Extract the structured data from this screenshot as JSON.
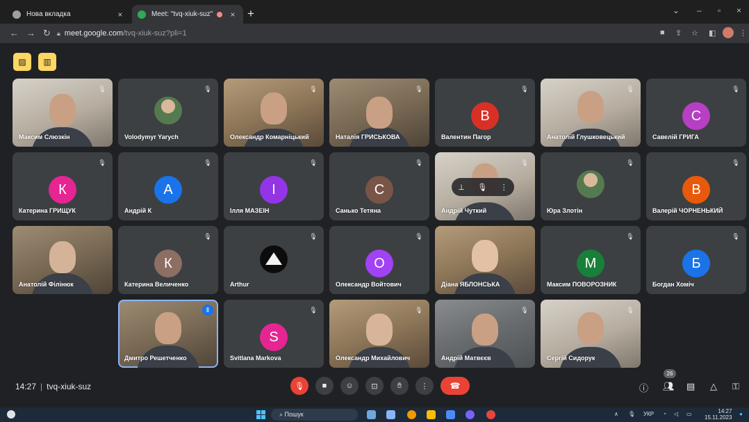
{
  "browser": {
    "tabs": [
      {
        "label": "Нова вкладка"
      },
      {
        "label": "Meet: \"tvq-xiuk-suz\""
      }
    ],
    "url_host": "meet.google.com",
    "url_path": "/tvq-xiuk-suz?pli=1"
  },
  "participants": [
    {
      "name": "Максим Слюзкін",
      "type": "video"
    },
    {
      "name": "Volodymyr Yarych",
      "type": "photo"
    },
    {
      "name": "Олександр Комарніцький",
      "type": "video"
    },
    {
      "name": "Наталія ГРИСЬКОВА",
      "type": "video"
    },
    {
      "name": "Валентин Пагор",
      "initial": "В",
      "color": "#d93025",
      "type": "initial"
    },
    {
      "name": "Анатолій Глушковецький",
      "type": "video"
    },
    {
      "name": "Савелій ГРИГА",
      "initial": "С",
      "color": "#b63fc4",
      "type": "initial"
    },
    {
      "name": "Катерина ГРИЩУК",
      "initial": "К",
      "color": "#e52592",
      "type": "initial"
    },
    {
      "name": "Андрій К",
      "initial": "А",
      "color": "#1a73e8",
      "type": "initial"
    },
    {
      "name": "Ілля МАЗЕІН",
      "initial": "І",
      "color": "#9334e6",
      "type": "initial"
    },
    {
      "name": "Санько Тетяна",
      "initial": "С",
      "color": "#795548",
      "type": "initial"
    },
    {
      "name": "Андрій Чуткий",
      "type": "video"
    },
    {
      "name": "Юра Злотін",
      "type": "photo"
    },
    {
      "name": "Валерій ЧОРНЕНЬКИЙ",
      "initial": "В",
      "color": "#e8590c",
      "type": "initial"
    },
    {
      "name": "Анатолій Філінюк",
      "type": "video"
    },
    {
      "name": "Катерина Величенко",
      "initial": "К",
      "color": "#8d6e63",
      "type": "initial"
    },
    {
      "name": "Arthur",
      "type": "logo"
    },
    {
      "name": "Олександр Войтович",
      "initial": "О",
      "color": "#a142f4",
      "type": "initial"
    },
    {
      "name": "Діана ЯБЛОНСЬКА",
      "type": "video"
    },
    {
      "name": "Максим ПОВОРОЗНИК",
      "initial": "М",
      "color": "#188038",
      "type": "initial"
    },
    {
      "name": "Богдан Хоміч",
      "initial": "Б",
      "color": "#1a73e8",
      "type": "initial"
    },
    {
      "name": "Дмитро Решетченко",
      "type": "video"
    },
    {
      "name": "Svitlana Markova",
      "initial": "S",
      "color": "#e52592",
      "type": "initial"
    },
    {
      "name": "Олександр Михайлович",
      "type": "video"
    },
    {
      "name": "Андрій Матвєєв",
      "type": "video"
    },
    {
      "name": "Сергій Сидорук",
      "type": "video"
    }
  ],
  "meeting": {
    "time": "14:27",
    "code": "tvq-xiuk-suz",
    "participant_count": "26"
  },
  "taskbar": {
    "search_placeholder": "Пошук",
    "language": "УКР",
    "time": "14:27",
    "date": "15.11.2023"
  },
  "colors": {
    "accent_blue": "#8ab4f8",
    "end_call": "#ea4335",
    "top_buttons": "#fdd663"
  }
}
